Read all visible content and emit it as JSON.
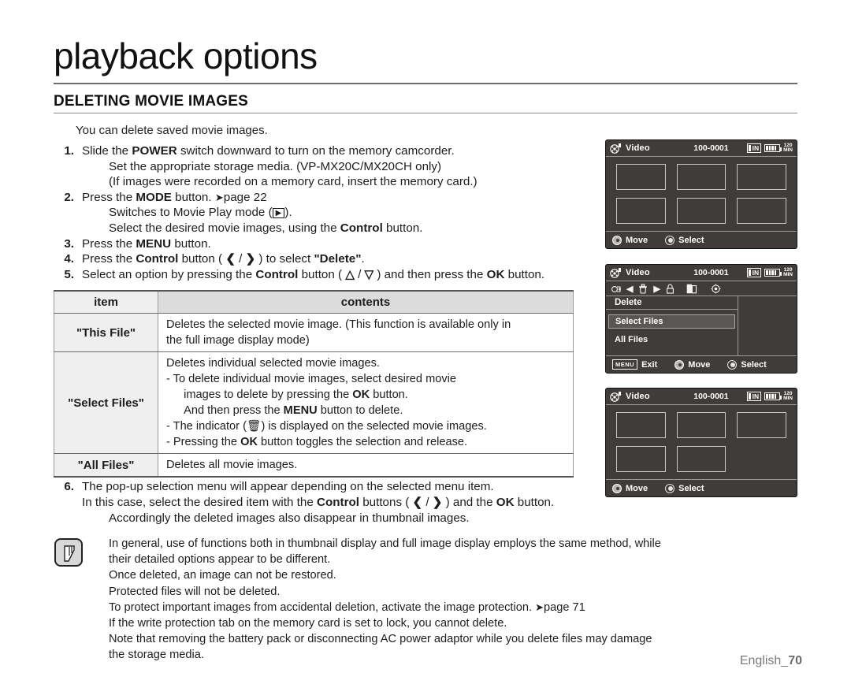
{
  "header": {
    "chapter_title": "playback options",
    "section_title": "DELETING MOVIE IMAGES",
    "intro": "You can delete saved movie images."
  },
  "steps": [
    {
      "num": "1.",
      "text_parts": [
        "Slide the ",
        "POWER",
        " switch downward to turn on the memory camcorder."
      ],
      "subs": [
        "Set the appropriate storage media. (VP-MX20C/MX20CH only)",
        "(If images were recorded on a memory card, insert the memory card.)"
      ]
    },
    {
      "num": "2.",
      "text": "Press the MODE button.",
      "pageref": "page 22",
      "subs": [
        "Switches to Movie Play mode (  ).",
        "Select the desired movie images, using the Control button."
      ]
    },
    {
      "num": "3.",
      "text": "Press the MENU button."
    },
    {
      "num": "4.",
      "text": "Press the Control button (  /  ) to select \"Delete\"."
    },
    {
      "num": "5.",
      "text": "Select an option by pressing the Control button (  /  ) and then press the OK button."
    }
  ],
  "step_labels": {
    "power": "POWER",
    "mode": "MODE",
    "menu": "MENU",
    "control": "Control",
    "ok": "OK",
    "delete_quoted": "\"Delete\"",
    "slide_pre": "Slide the ",
    "slide_post": " switch downward to turn on the memory camcorder.",
    "press_the": "Press the ",
    "button_period": " button.",
    "mode_pageref": "page 22",
    "sub1a": "Set the appropriate storage media. (VP-MX20C/MX20CH only)",
    "sub1b": "(If images were recorded on a memory card, insert the memory card.)",
    "sub2a_pre": "Switches to Movie Play mode (",
    "sub2a_post": ").",
    "sub2b_pre": "Select the desired movie images, using the ",
    "sub2b_post": " button.",
    "s4_pre": "Press the ",
    "s4_mid": " button ( ",
    "s4_mid2": " ) to select ",
    "s5_pre": "Select an option by pressing the ",
    "s5_mid": " button ( ",
    "s5_mid2": " ) and then press the ",
    "s5_post": " button."
  },
  "table": {
    "headers": [
      "item",
      "contents"
    ],
    "rows": [
      {
        "item": "\"This File\"",
        "contents": [
          "Deletes the selected movie image. (This function is available only in the full image display mode)"
        ]
      },
      {
        "item": "\"Select Files\"",
        "contents": [
          "Deletes individual selected movie images.",
          "-  To delete individual movie images, select desired movie images to delete by pressing the OK button.",
          "And then press the MENU button to delete.",
          "-  The indicator (  ) is displayed on the selected movie images.",
          "-  Pressing the OK button toggles the selection and release."
        ]
      },
      {
        "item": "\"All Files\"",
        "contents": [
          "Deletes all movie images."
        ]
      }
    ]
  },
  "table_text": {
    "this_file_line1": "Deletes the selected movie image. (This function is available only in",
    "this_file_line2": "the full image display mode)",
    "sf_line1": "Deletes individual selected movie images.",
    "sf_line2a": "-  To delete individual movie images, select desired movie",
    "sf_line2b": "images to delete by pressing the ",
    "sf_line2c": " button.",
    "sf_line3a": "And then press the ",
    "sf_line3b": " button to delete.",
    "sf_line4a": "-  The indicator (",
    "sf_line4b": ") is displayed on the selected movie images.",
    "sf_line5a": "-  Pressing the ",
    "sf_line5b": " button toggles the selection and release.",
    "all_files": "Deletes all movie images."
  },
  "step6": {
    "num": "6.",
    "line1": "The pop-up selection menu will appear depending on the selected menu item.",
    "line2a": "In this case, select the desired item with the ",
    "line2b": " buttons ( ",
    "line2c": " ) and the ",
    "line2d": " button.",
    "line3": "Accordingly the deleted images also disappear in thumbnail images."
  },
  "note": {
    "lines": [
      "In general, use of functions both in thumbnail display and full image display employs the same method, while",
      "their detailed options appear to be different.",
      "Once deleted, an image can not be restored.",
      "Protected files will not be deleted.",
      "To protect important images from accidental deletion, activate the image protection.",
      "If the write protection tab on the memory card is set to lock, you cannot delete.",
      "Note that removing the battery pack or disconnecting AC power adaptor while you delete files may damage",
      "the storage media."
    ],
    "pageref": "page 71"
  },
  "footer": {
    "label": "English_",
    "page": "70"
  },
  "lcd": {
    "title": "Video",
    "file_no": "100-0001",
    "badge_in": "IN",
    "rec_time_top": "120",
    "rec_time_bottom": "MIN",
    "move_label": "Move",
    "select_label": "Select",
    "exit_label": "Exit",
    "menu_key": "MENU",
    "menu": {
      "header_label": "Delete",
      "items": [
        {
          "label": "Select Files",
          "highlighted": true
        },
        {
          "label": "All Files",
          "highlighted": false
        }
      ],
      "icons": [
        "playback-icon",
        "left-chevron-icon",
        "trash-icon",
        "right-chevron-icon",
        "lock-icon",
        "copy-icon",
        "gear-icon"
      ]
    },
    "screen1_thumbs": 6,
    "screen3_thumbs": 5
  },
  "colors": {
    "lcd_bg": "#3f3c39",
    "lcd_line": "#9c9894",
    "table_header_bg": "#dcdcdc",
    "table_item_bg": "#efefef",
    "footer_text": "#7a7a7a"
  }
}
